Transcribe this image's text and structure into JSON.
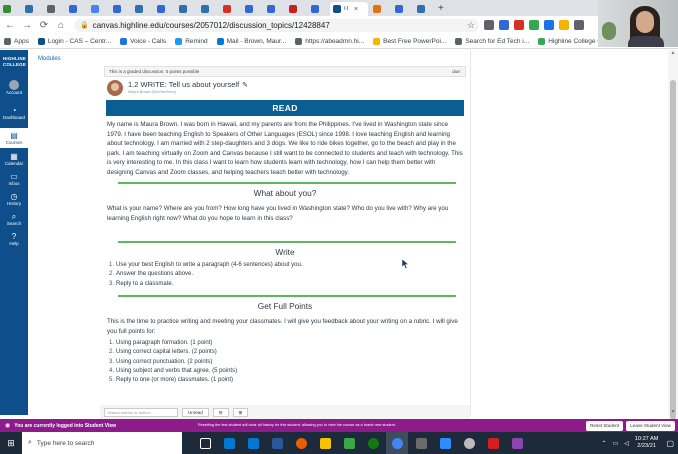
{
  "browser": {
    "tabs": [
      {
        "label": "",
        "color": "#3b8a3a"
      },
      {
        "label": "",
        "color": "#2e6fb0"
      },
      {
        "label": "",
        "color": "#5f6368"
      },
      {
        "label": "",
        "color": "#3367d6"
      },
      {
        "label": "",
        "color": "#4285f4"
      },
      {
        "label": "",
        "color": "#3367d6"
      },
      {
        "label": "",
        "color": "#2e6fb0"
      },
      {
        "label": "",
        "color": "#3367d6"
      },
      {
        "label": "",
        "color": "#2e6fb0"
      },
      {
        "label": "",
        "color": "#2e6fb0"
      },
      {
        "label": "",
        "color": "#d93025"
      },
      {
        "label": "",
        "color": "#3367d6"
      },
      {
        "label": "",
        "color": "#3367d6"
      },
      {
        "label": "",
        "color": "#c5221f"
      },
      {
        "label": "",
        "color": "#3367d6"
      },
      {
        "label": "",
        "color": "#e8710a"
      },
      {
        "label": "",
        "color": "#3367d6"
      },
      {
        "label": "",
        "color": "#2e6fb0"
      }
    ],
    "active_tab": {
      "label": "Tł",
      "close": "×",
      "color": "#0e4e8a"
    },
    "new_tab": "+",
    "url": "canvas.highline.edu/courses/2057012/discussion_topics/12428847",
    "bookmarks": [
      {
        "label": "Apps",
        "color": "#5f6368"
      },
      {
        "label": "Login - CAS – Centr...",
        "color": "#0e4e8a"
      },
      {
        "label": "Voice - Calls",
        "color": "#1a73e8"
      },
      {
        "label": "Remind",
        "color": "#2196f3"
      },
      {
        "label": "Mail - Brown, Maur...",
        "color": "#0078d4"
      },
      {
        "label": "https://abeadmn.hi...",
        "color": "#5f6368"
      },
      {
        "label": "Best Free PowerPoi...",
        "color": "#f4b400"
      },
      {
        "label": "Search for Ed Tech i...",
        "color": "#5f6368"
      },
      {
        "label": "Highline College G...",
        "color": "#34a853"
      }
    ]
  },
  "canvas": {
    "logo": "HIGHLINE COLLEGE",
    "global_nav": [
      {
        "label": "Account",
        "icon": "account-icon"
      },
      {
        "label": "Dashboard",
        "icon": "dashboard-icon"
      },
      {
        "label": "Courses",
        "icon": "courses-icon"
      },
      {
        "label": "Calendar",
        "icon": "calendar-icon"
      },
      {
        "label": "Inbox",
        "icon": "inbox-icon"
      },
      {
        "label": "History",
        "icon": "history-icon"
      },
      {
        "label": "Search",
        "icon": "search-icon"
      },
      {
        "label": "Help",
        "icon": "help-icon"
      }
    ],
    "course_nav_link": "Modules",
    "graded_notice": "This is a graded discussion: 0 points possible",
    "graded_right": "due:",
    "post": {
      "title": "1.2 WRITE: Tell us about yourself",
      "author": "Maura Brown (She/her/hers)"
    },
    "read_banner": "READ",
    "intro_paragraph": "My name is Maura Brown. I was born in Hawaii, and my parents are from the Philippines. I've lived in Washington state since 1979. I have been teaching English to Speakers of Other Languages (ESOL) since 1998. I love teaching English and learning about technology. I am married with 2 step-daughters and 3 dogs. We like to ride bikes together, go to the beach and play in the park. I am teaching virtually on Zoom and Canvas because I still want to be connected to students and teach with technology. This is very interesting to me. In this class I want to learn how students learn with technology, how I can help them better with designing Canvas and Zoom classes, and helping teachers teach better with technology.",
    "section_about": {
      "title": "What about you?",
      "text": "What is your name? Where are you from? How long have you lived in Washington state? Who do you live with? Why are you learning English right now? What do you hope to learn in this class?"
    },
    "section_write": {
      "title": "Write",
      "items": [
        {
          "num": "1.",
          "text": "Use your best English to write a paragraph (4-6 sentences) about you."
        },
        {
          "num": "2.",
          "text": "Answer the questions above."
        },
        {
          "num": "3.",
          "text": "Reply to a classmate."
        }
      ]
    },
    "section_points": {
      "title": "Get Full Points",
      "text": "This is the time to practice writing and meeting your classmates. I will give you feedback about your writing on a rubric. I will give you full points for:",
      "items": [
        {
          "num": "1.",
          "text": "Using paragraph formation. (1 point)"
        },
        {
          "num": "2.",
          "text": "Using correct capital letters. (2 points)"
        },
        {
          "num": "3.",
          "text": "Using correct punctuation. (2 points)"
        },
        {
          "num": "4.",
          "text": "Using subject and verbs that agree. (5 points)"
        },
        {
          "num": "5.",
          "text": "Reply to one (or more) classmates. (1 point)"
        }
      ]
    },
    "reply_bar": {
      "search_placeholder": "Search entries or author...",
      "unread_label": "Unread"
    },
    "student_view": {
      "message": "You are currently logged into Student View",
      "note": "Resetting the test student will clear all history for this student, allowing you to view the course as a brand new student.",
      "reset_label": "Reset Student",
      "leave_label": "Leave Student View",
      "color": "#8e1b8a"
    }
  },
  "taskbar": {
    "search_placeholder": "Type here to search",
    "time": "10:27 AM",
    "date": "2/23/21",
    "apps": [
      {
        "name": "task-view",
        "color": "#ffffff"
      },
      {
        "name": "outlook",
        "color": "#0078d4"
      },
      {
        "name": "outlook-2",
        "color": "#0078d4"
      },
      {
        "name": "word",
        "color": "#2b579a"
      },
      {
        "name": "firefox",
        "color": "#e66000"
      },
      {
        "name": "explorer",
        "color": "#f8c300"
      },
      {
        "name": "camtasia",
        "color": "#3aa845"
      },
      {
        "name": "xbox",
        "color": "#107c10"
      },
      {
        "name": "chrome",
        "color": "#4285f4"
      },
      {
        "name": "screencast",
        "color": "#6b6b6b"
      },
      {
        "name": "zoom",
        "color": "#2d8cff"
      },
      {
        "name": "settings",
        "color": "#bbbbbb"
      },
      {
        "name": "acrobat",
        "color": "#d71e1e"
      },
      {
        "name": "snip",
        "color": "#8e44ad"
      }
    ]
  }
}
